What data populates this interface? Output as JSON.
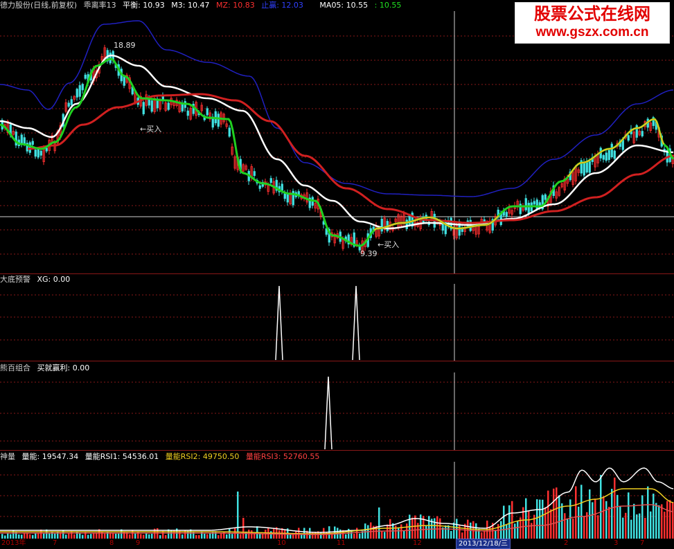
{
  "main_header": {
    "title": "德力股份(日线,前复权)",
    "ratio": "乖离率13",
    "balance": "平衡: 10.93",
    "m3": "M3: 10.47",
    "mz": "MZ: 10.83",
    "stop": "止赢: 12.03",
    "ma05": "MA05: 10.55",
    "ma05_val": ": 10.55"
  },
  "annotations": {
    "high": "18.89",
    "buy1": "←买入",
    "buy2": "←买入",
    "low": "9.39"
  },
  "panel2_header": {
    "title": "大底预警",
    "xg": "XG: 0.00"
  },
  "panel3_header": {
    "title": "熊百组合",
    "value": "买就赢利: 0.00"
  },
  "panel4_header": {
    "title": "神量",
    "energy": "量能: 19547.34",
    "rsi1": "量能RSI1: 54536.01",
    "rsi2": "量能RSI2: 49750.50",
    "rsi3": "量能RSI3: 52760.55"
  },
  "watermark": {
    "title": "股票公式在线网",
    "url": "www.gszx.com.cn"
  },
  "x_axis": {
    "labels": [
      "2013年",
      "7",
      "8",
      "9",
      "10",
      "11",
      "12",
      "2",
      "3",
      "7"
    ],
    "selected_date": "2013/12/18/三"
  },
  "colors": {
    "background": "#000000",
    "grid": "#8a1818",
    "up": "#ff3030",
    "down": "#40e0e0",
    "white_line": "#ffffff",
    "red_line": "#d02020",
    "blue_band": "#2020c0",
    "green_line": "#20d020",
    "yellow_line": "#f0c020"
  }
}
